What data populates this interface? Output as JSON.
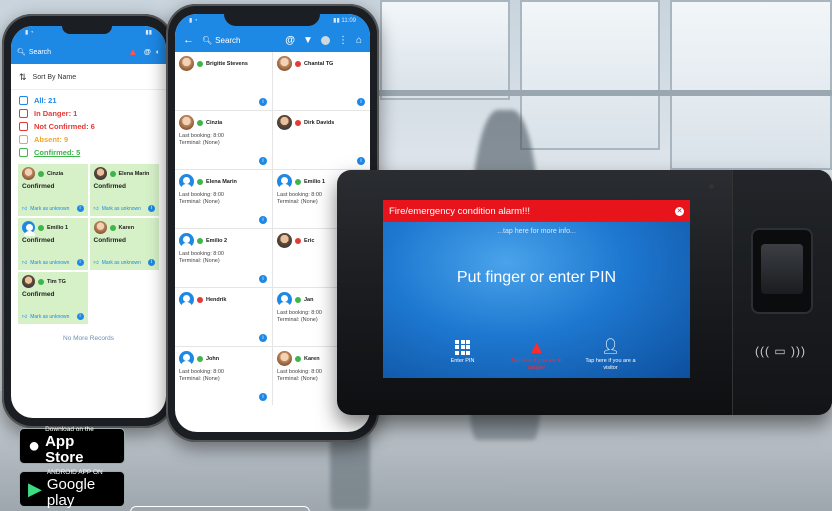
{
  "phone_left": {
    "search_label": "Search",
    "sort_label": "Sort By Name",
    "filters": [
      {
        "label": "All: 21",
        "color": "#1e88e5"
      },
      {
        "label": "In Danger: 1",
        "color": "#e53935"
      },
      {
        "label": "Not Confirmed: 6",
        "color": "#e53935"
      },
      {
        "label": "Absent: 9",
        "color": "#f5a623"
      },
      {
        "label": "Confirmed: 5",
        "color": "#3cb54a"
      }
    ],
    "cards": [
      {
        "name": "Cinzia",
        "status": "Confirmed",
        "action": "Mark as unknown"
      },
      {
        "name": "Elena Marin",
        "status": "Confirmed",
        "action": "Mark as unknown"
      },
      {
        "name": "Emilio 1",
        "status": "Confirmed",
        "action": "Mark as unknown"
      },
      {
        "name": "Karen",
        "status": "Confirmed",
        "action": "Mark as unknown"
      },
      {
        "name": "Tim TG",
        "status": "Confirmed",
        "action": "Mark as unknown"
      }
    ],
    "no_more": "No More Records"
  },
  "phone_right": {
    "search_label": "Search",
    "persons": [
      {
        "name": "Brigitte Stevens",
        "dot": "green",
        "avatar": "photo-f",
        "booking": "",
        "terminal": ""
      },
      {
        "name": "Chantal TG",
        "dot": "red",
        "avatar": "photo-f",
        "booking": "",
        "terminal": ""
      },
      {
        "name": "Cinzia",
        "dot": "green",
        "avatar": "photo-f",
        "booking": "Last booking: 8:00",
        "terminal": "Terminal: (None)"
      },
      {
        "name": "Dirk Davids",
        "dot": "red",
        "avatar": "photo-m",
        "booking": "",
        "terminal": ""
      },
      {
        "name": "Elena Marin",
        "dot": "green",
        "avatar": "generic",
        "booking": "Last booking: 8:00",
        "terminal": "Terminal: (None)"
      },
      {
        "name": "Emilio 1",
        "dot": "green",
        "avatar": "generic",
        "booking": "Last booking: 8:00",
        "terminal": "Terminal: (None)"
      },
      {
        "name": "Emilio 2",
        "dot": "green",
        "avatar": "generic",
        "booking": "Last booking: 8:00",
        "terminal": "Terminal: (None)"
      },
      {
        "name": "Eric",
        "dot": "red",
        "avatar": "photo-m",
        "booking": "",
        "terminal": ""
      },
      {
        "name": "Hendrik",
        "dot": "red",
        "avatar": "generic",
        "booking": "",
        "terminal": ""
      },
      {
        "name": "Jan",
        "dot": "green",
        "avatar": "generic",
        "booking": "Last booking: 8:00",
        "terminal": "Terminal: (None)"
      },
      {
        "name": "John",
        "dot": "green",
        "avatar": "generic",
        "booking": "Last booking: 8:00",
        "terminal": "Terminal: (None)"
      },
      {
        "name": "Karen",
        "dot": "green",
        "avatar": "photo-f",
        "booking": "Last booking: 8:00",
        "terminal": "Terminal: (None)"
      }
    ]
  },
  "terminal": {
    "alarm_title": "Fire/emergency condition alarm!!!",
    "more_info": "...tap here for more info...",
    "main_prompt": "Put finger or enter PIN",
    "actions": [
      {
        "label": "Enter PIN",
        "icon": "keypad-icon",
        "red": false
      },
      {
        "label": "Tap here if you are in danger",
        "icon": "warning-icon",
        "red": true
      },
      {
        "label": "Tap here if you are a visitor",
        "icon": "visitor-icon",
        "red": false
      }
    ],
    "nfc_symbol": "((( ▭ )))"
  },
  "badges": {
    "apple_small": "Download on the",
    "apple_big": "App Store",
    "google_small": "ANDROID APP ON",
    "google_big": "Google play"
  },
  "colors": {
    "accent": "#1e88e5",
    "alarm": "#e8141c",
    "confirmed_bg": "#d6f0c8"
  }
}
